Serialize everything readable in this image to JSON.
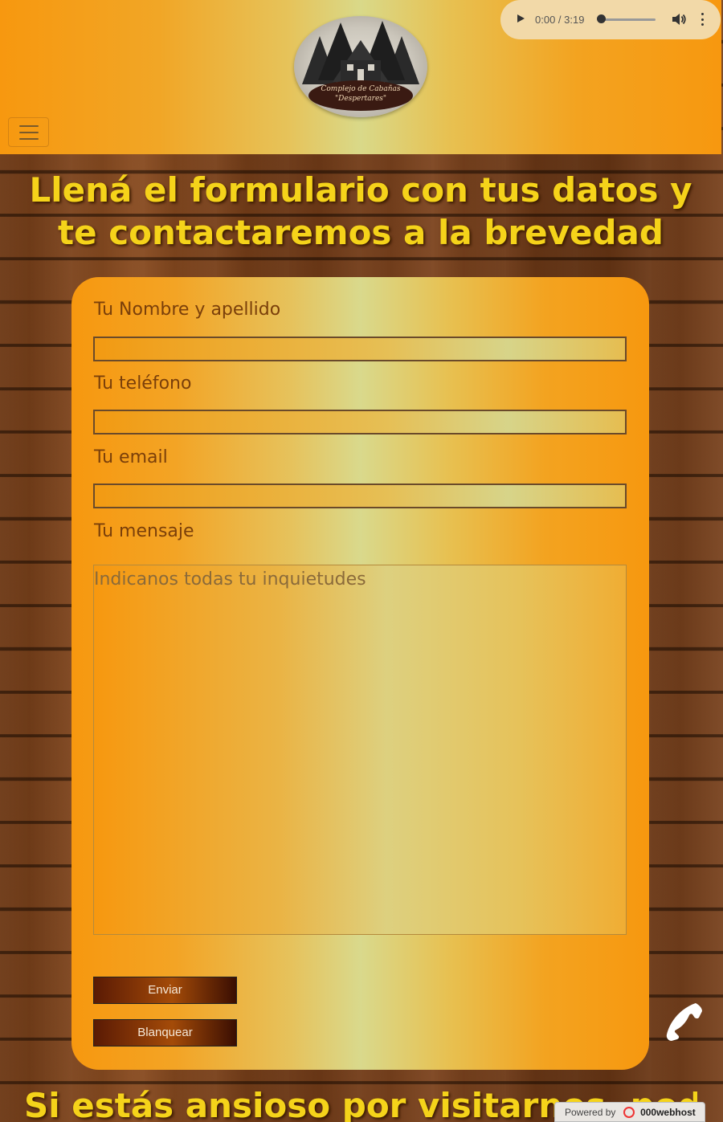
{
  "header": {
    "logo_line1": "Complejo de Cabañas",
    "logo_line2": "\"Despertares\"",
    "menu_icon": "hamburger-icon"
  },
  "audio": {
    "time": "0:00 / 3:19",
    "progress": 0,
    "play_icon": "play-icon",
    "volume_icon": "volume-icon",
    "more_icon": "more-vertical-icon"
  },
  "heading": "Llená el formulario con tus datos y te contactaremos a la brevedad",
  "form": {
    "name_label": "Tu Nombre y apellido",
    "name_value": "",
    "phone_label": "Tu teléfono",
    "phone_value": "",
    "email_label": "Tu email",
    "email_value": "",
    "message_label": "Tu mensaje",
    "message_placeholder": "Indicanos todas tu inquietudes",
    "submit_label": "Enviar",
    "reset_label": "Blanquear"
  },
  "phone_icon": "phone-icon",
  "footer_heading": "Si estás ansioso por visitarnos, podés",
  "powered": {
    "prefix": "Powered by",
    "brand": "000webhost"
  },
  "colors": {
    "accent_orange": "#f7980f",
    "heading_yellow": "#f5d31a",
    "label_brown": "#7a3f0a"
  }
}
